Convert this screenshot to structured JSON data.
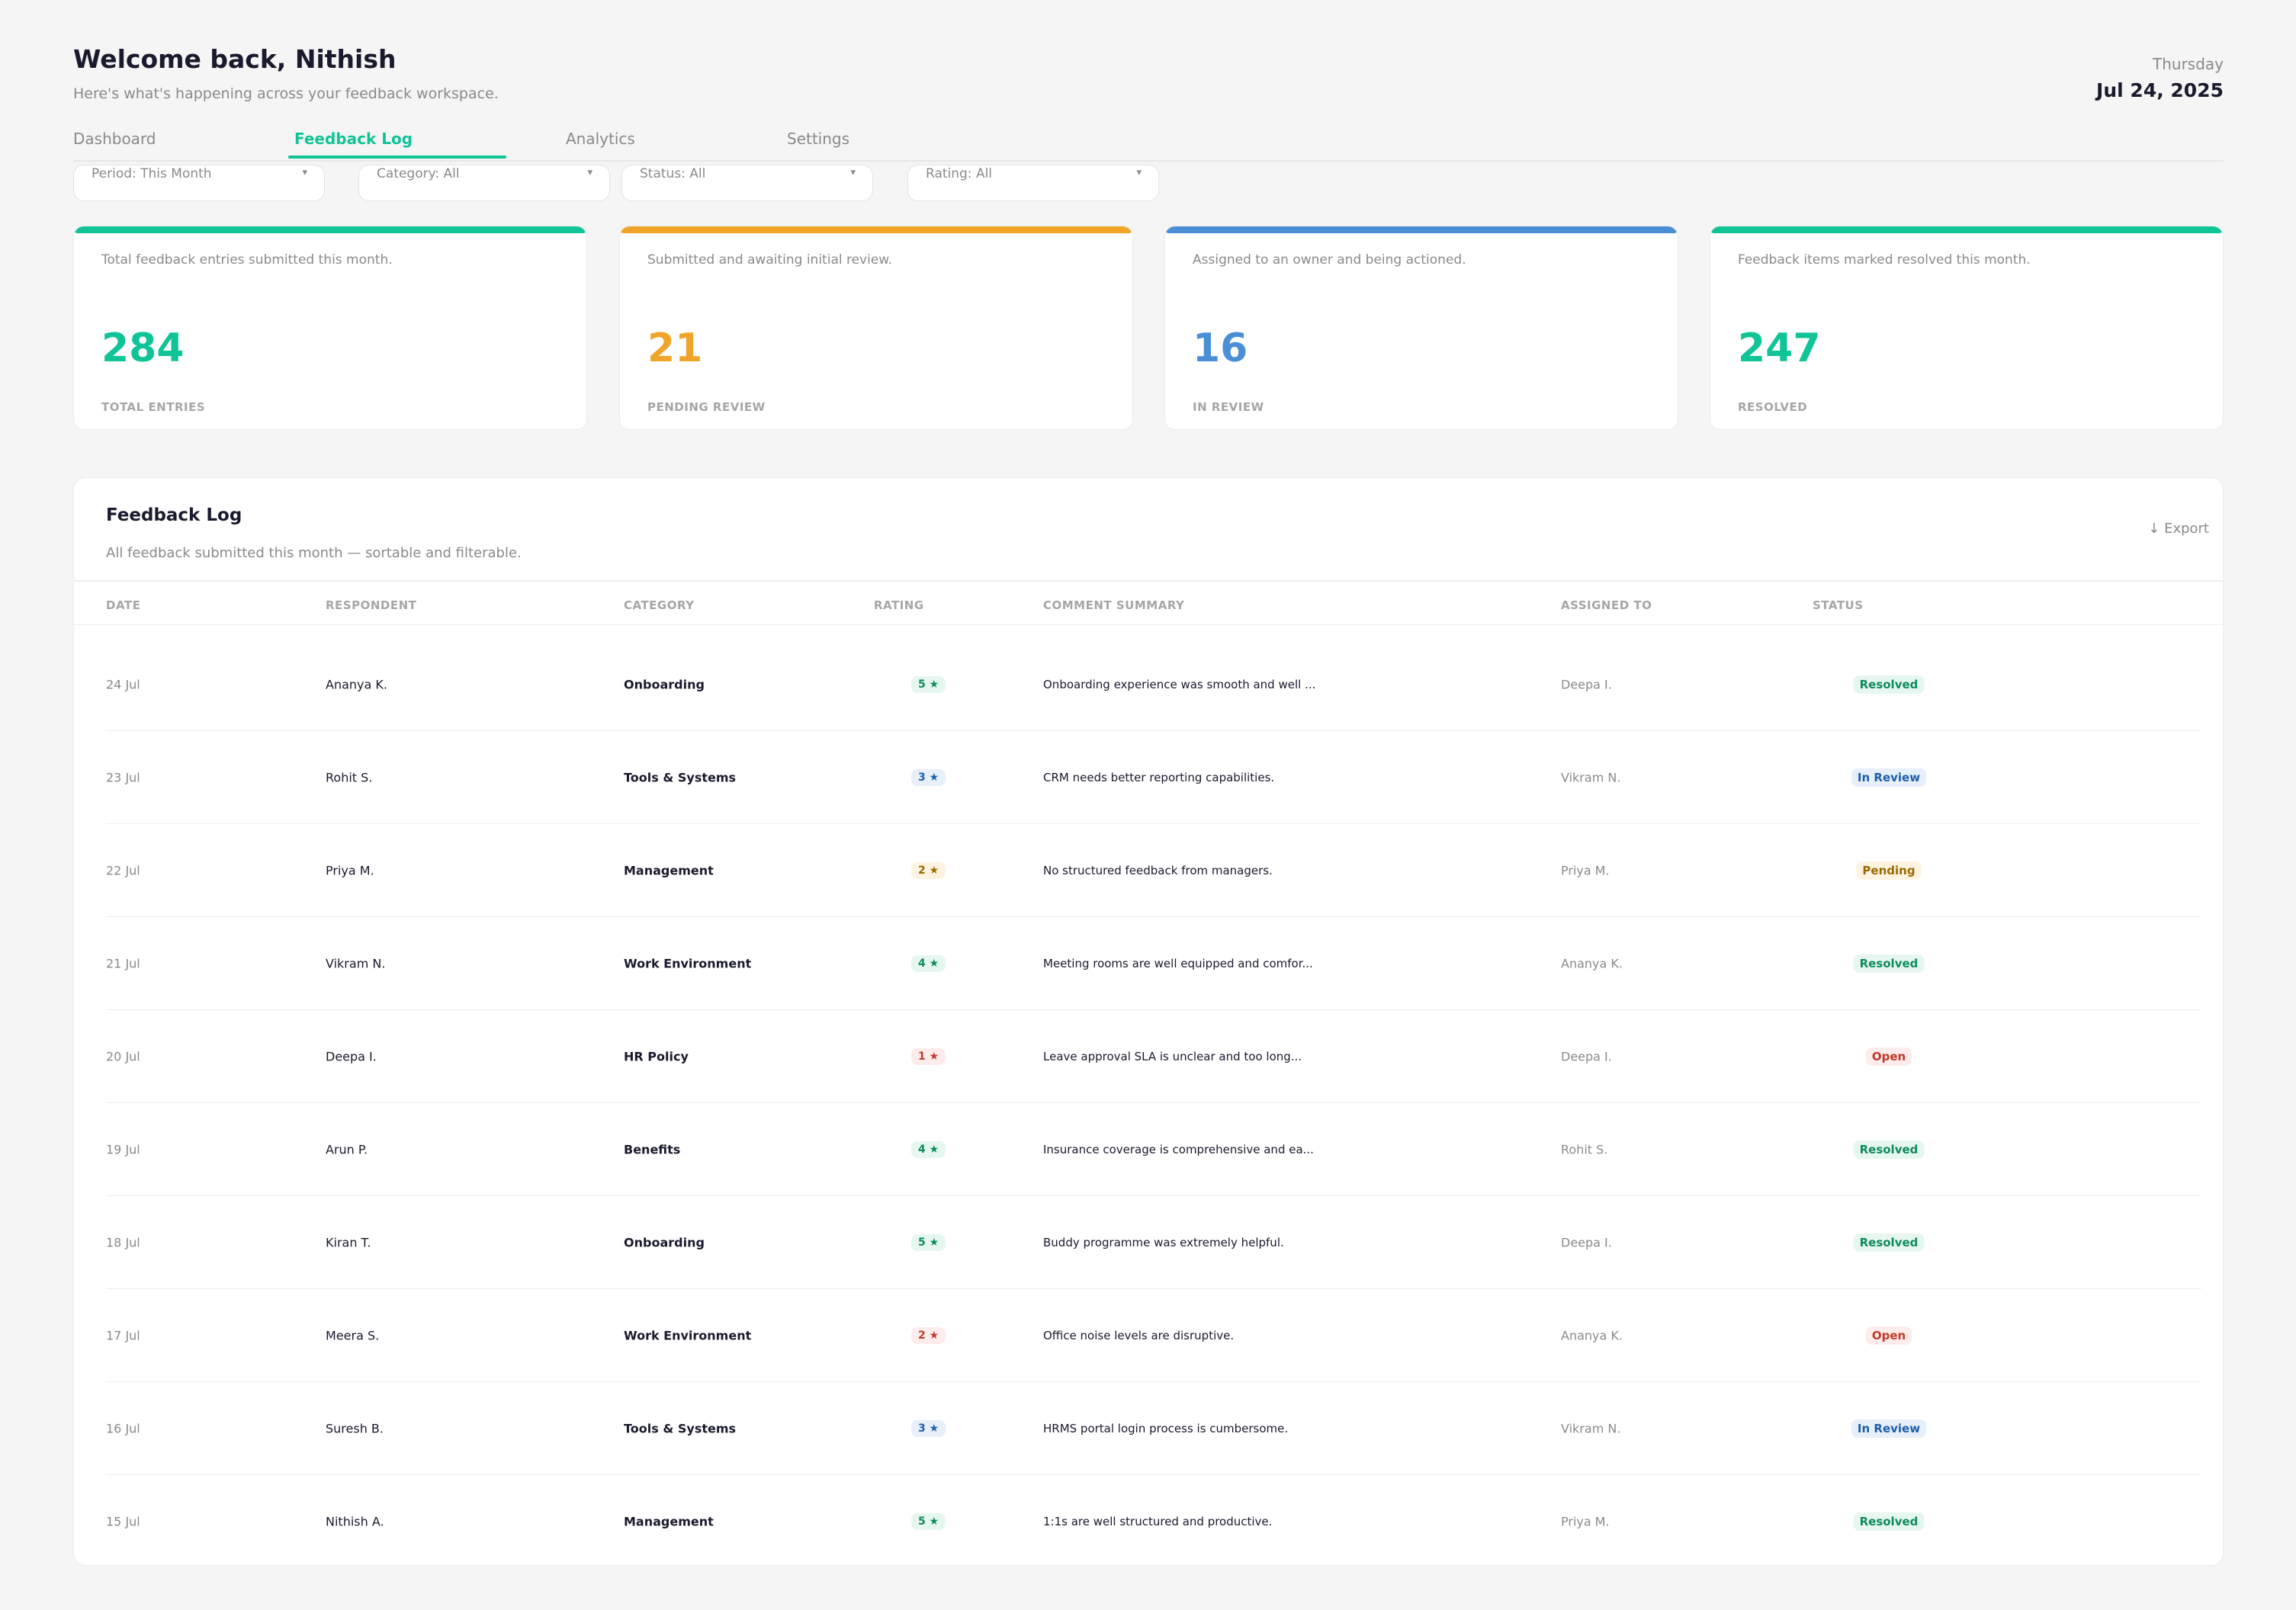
{
  "header": {
    "welcome": "Welcome back, Nithish",
    "subtitle": "Here's what's happening across your feedback workspace.",
    "day": "Thursday",
    "date": "Jul 24, 2025"
  },
  "tabs": [
    {
      "label": "Dashboard",
      "active": false
    },
    {
      "label": "Feedback Log",
      "active": true
    },
    {
      "label": "Analytics",
      "active": false
    },
    {
      "label": "Settings",
      "active": false
    }
  ],
  "filters": [
    {
      "label": "Period: This Month"
    },
    {
      "label": "Category: All"
    },
    {
      "label": "Status: All"
    },
    {
      "label": "Rating: All"
    }
  ],
  "filter_caret": "▾",
  "stats": [
    {
      "desc": "Total feedback entries submitted this month.",
      "value": "284",
      "caption": "TOTAL ENTRIES",
      "color": "#10c497"
    },
    {
      "desc": "Submitted and awaiting initial review.",
      "value": "21",
      "caption": "PENDING REVIEW",
      "color": "#f0a52a"
    },
    {
      "desc": "Assigned to an owner and being actioned.",
      "value": "16",
      "caption": "IN REVIEW",
      "color": "#4a8fd6"
    },
    {
      "desc": "Feedback items marked resolved this month.",
      "value": "247",
      "caption": "RESOLVED",
      "color": "#10c497"
    }
  ],
  "log": {
    "title": "Feedback Log",
    "subtitle": "All feedback submitted this month — sortable and filterable.",
    "export_label": "↓ Export",
    "columns": [
      "DATE",
      "RESPONDENT",
      "CATEGORY",
      "RATING",
      "COMMENT SUMMARY",
      "ASSIGNED TO",
      "STATUS"
    ],
    "rows": [
      {
        "date": "24 Jul",
        "respondent": "Ananya K.",
        "category": "Onboarding",
        "rating": "5 ★",
        "comment": "Onboarding experience was smooth and well ...",
        "assigned": "Deepa I.",
        "status": "Resolved"
      },
      {
        "date": "23 Jul",
        "respondent": "Rohit S.",
        "category": "Tools & Systems",
        "rating": "3 ★",
        "comment": "CRM needs better reporting capabilities.",
        "assigned": "Vikram N.",
        "status": "In Review"
      },
      {
        "date": "22 Jul",
        "respondent": "Priya M.",
        "category": "Management",
        "rating": "2 ★",
        "comment": "No structured feedback from managers.",
        "assigned": "Priya M.",
        "status": "Pending"
      },
      {
        "date": "21 Jul",
        "respondent": "Vikram N.",
        "category": "Work Environment",
        "rating": "4 ★",
        "comment": "Meeting rooms are well equipped and comfor...",
        "assigned": "Ananya K.",
        "status": "Resolved"
      },
      {
        "date": "20 Jul",
        "respondent": "Deepa I.",
        "category": "HR Policy",
        "rating": "1 ★",
        "comment": "Leave approval SLA is unclear and too long...",
        "assigned": "Deepa I.",
        "status": "Open"
      },
      {
        "date": "19 Jul",
        "respondent": "Arun P.",
        "category": "Benefits",
        "rating": "4 ★",
        "comment": "Insurance coverage is comprehensive and ea...",
        "assigned": "Rohit S.",
        "status": "Resolved"
      },
      {
        "date": "18 Jul",
        "respondent": "Kiran T.",
        "category": "Onboarding",
        "rating": "5 ★",
        "comment": "Buddy programme was extremely helpful.",
        "assigned": "Deepa I.",
        "status": "Resolved"
      },
      {
        "date": "17 Jul",
        "respondent": "Meera S.",
        "category": "Work Environment",
        "rating": "2 ★",
        "comment": "Office noise levels are disruptive.",
        "assigned": "Ananya K.",
        "status": "Open"
      },
      {
        "date": "16 Jul",
        "respondent": "Suresh B.",
        "category": "Tools & Systems",
        "rating": "3 ★",
        "comment": "HRMS portal login process is cumbersome.",
        "assigned": "Vikram N.",
        "status": "In Review"
      },
      {
        "date": "15 Jul",
        "respondent": "Nithish A.",
        "category": "Management",
        "rating": "5 ★",
        "comment": "1:1s are well structured and productive.",
        "assigned": "Priya M.",
        "status": "Resolved"
      }
    ]
  },
  "colors": {
    "accent": "#10c497",
    "pending": "#f0a52a",
    "in_review": "#4a8fd6"
  }
}
